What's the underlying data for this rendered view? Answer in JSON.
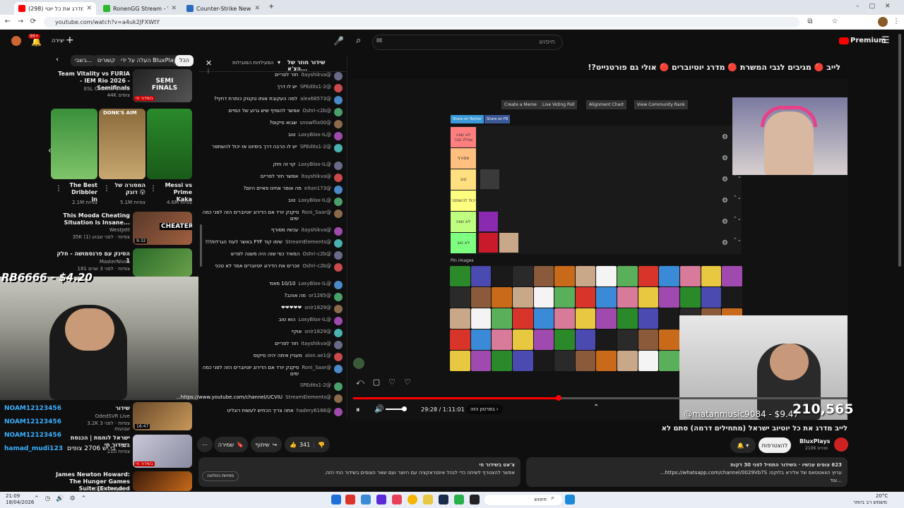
{
  "browser": {
    "tabs": [
      {
        "title": "(298) לייב מדרג את כל יוטי...",
        "active": true
      },
      {
        "title": "RonenGG Stream - Watch Live",
        "active": false
      },
      {
        "title": "Counter-Strike News & Covera...",
        "active": false
      }
    ],
    "new_tab": "+",
    "url": "youtube.com/watch?v=a4uk2JFXWtY"
  },
  "yt_header": {
    "notif_count": "99+",
    "create_label": "יצירה",
    "search_placeholder": "חיפוש",
    "premium_label": "Premium"
  },
  "sidebar": {
    "chips": [
      "הכל",
      "העלה על ידי BluxPlays",
      "קשורים",
      "בשבי..."
    ],
    "items": [
      {
        "title": "Team Vitality vs FURIA - IEM Rio 2026 - Semifinals",
        "channel": "ESL Counter-Strike",
        "meta": "44K צופים",
        "badge": "בשידור חי"
      },
      {
        "title": "This Mooda Cheating Situation is Insane...",
        "channel": "WestJett",
        "meta": "35K צפיות · לפני שבוע (1)",
        "badge": "9:32"
      },
      {
        "title": "הסינק עם פרנסמושה - חלק 1",
        "channel": "MasterNivos",
        "meta": "181 צפיות · לפני 3 שנים"
      },
      {
        "title": "שידור",
        "channel": "OdedSVR Live",
        "meta": "3.2K צפיות · לפני 3 שבועות",
        "badge": "16:47"
      },
      {
        "title": "ישראל לוחמת | הכנסת בשידור חי",
        "channel": "C14",
        "meta": "210 צפיות",
        "badge": "בשידור חי"
      },
      {
        "title": "James Newton Howard: The Hunger Games Suite [Extended",
        "channel": "Gilles Nuytens",
        "meta": ""
      }
    ],
    "shorts": [
      {
        "title": "The Best Dribbler in",
        "meta": "2.1M צפיות"
      },
      {
        "title": "המסורה של דונק 😮",
        "meta": "5.1M צפיות"
      },
      {
        "title": "Messi vs Prime Kaka",
        "meta": "4.6M צפיות"
      }
    ],
    "shorts_thumb_label": "DONK'S AIM",
    "semi_label": "SEMI FINALS",
    "cheater_label": "CHEATER?"
  },
  "overlay": {
    "donation": "RB6666 - $4.20",
    "chat_names": [
      "NOAM12123456",
      "NOAM12123456",
      "NOAM12123456",
      "hamad_mudi123"
    ],
    "chat_last": "כי יש 2706 צופים",
    "counter": "122"
  },
  "chat": {
    "title": "שידור חוזר של הצ'א...",
    "mode": "הפעילויות המובילות",
    "messages": [
      {
        "author": "@itayshikva",
        "text": "חזר לפריים"
      },
      {
        "author": "@SPEdits1-2",
        "text": "יש לו דרך"
      },
      {
        "author": "@alex68573",
        "text": "למה העקובת אותו טקנוק כותרת דחיף?"
      },
      {
        "author": "@Oshri-c2b",
        "text": "אפשר להוסיף שיש גרוע של המיים"
      },
      {
        "author": "@snowflix00",
        "text": "שבוא סיקוס?"
      },
      {
        "author": "@LoxyBlox-IL",
        "text": "טוב"
      },
      {
        "author": "@SPEdits1-2",
        "text": "יש לו הרבה דרך בימינט אז יכול להשתפר"
      },
      {
        "author": "@LoxyBlox-IL",
        "text": "קוי זה חזק"
      },
      {
        "author": "@itayshikva",
        "text": "אפשר חזר לפריים"
      },
      {
        "author": "@eitan173",
        "text": "מה אומר אחינו פאיים היום?"
      },
      {
        "author": "@LoxyBlox-IL",
        "text": "טוב"
      },
      {
        "author": "@Roni_Saar",
        "text": "סיקנק יורד אם הדירוג יוטיוברים הזה לפני כמה ימים"
      },
      {
        "author": "@itayshikva",
        "text": "עכשיו מסורף"
      },
      {
        "author": "@StreamElements",
        "text": "שימו קוד FYF באשר לעוד הגרלות!!!"
      },
      {
        "author": "@Oshri-c2b",
        "text": "המאיר כפי שזה היה משנה לפרש"
      },
      {
        "author": "@Oshri-c2b",
        "text": "זוכרים את הדירוג יוטיוברים אמר לא טכני"
      },
      {
        "author": "@LoxyBlox-IL",
        "text": "10/10 מאוד"
      },
      {
        "author": "@or1265",
        "text": "מה אוהב?"
      },
      {
        "author": "@snir1829",
        "text": "❤❤❤❤❤"
      },
      {
        "author": "@LoxyBlox-IL",
        "text": "הוא טוב"
      },
      {
        "author": "@snir1829",
        "text": "אוקיי"
      },
      {
        "author": "@itayshikva",
        "text": "חזר לפריים"
      },
      {
        "author": "@alon.ae1",
        "text": "מעניין אימה יהיה סיקוס"
      },
      {
        "author": "@Roni_Saar",
        "text": "סיקנק יורד אם הדירוג יוטיוברים הזה לפני כמה ימים"
      },
      {
        "author": "@SPEdits1-2",
        "text": ""
      },
      {
        "author": "@StreamElements",
        "text": "https://www.youtube.com/channel/UCVIU..."
      },
      {
        "author": "@hadery6166",
        "text": "אתה צריך הכחיש לעשות רוגליט"
      }
    ]
  },
  "video": {
    "title": "לייב 🔴 מגיבים לגבי המשרת 🔴 מדרג יוטיוברים 🔴 אולי גם פורטנייט?!",
    "tier_buttons": [
      "Create a Meme",
      "Live Voting Poll",
      "Alignment Chart",
      "View Community Rank"
    ],
    "share_buttons": [
      "Share on Twitter",
      "Share on FB"
    ],
    "tiers": [
      {
        "label": "לא שווה אפילו חבר",
        "color": "#ff7f7f"
      },
      {
        "label": "מסורף",
        "color": "#ffbf7f"
      },
      {
        "label": "טוב",
        "color": "#ffdf7f"
      },
      {
        "label": "יכול להשתפר",
        "color": "#ffff7f"
      },
      {
        "label": "לא שווה",
        "color": "#bfff7f"
      },
      {
        "label": "לא טוב",
        "color": "#7fff7f"
      }
    ],
    "pool_label": "Pin images",
    "cam_tag": "@matanmusic9084 - $9.47",
    "viewer_count": "210,565",
    "time_current": "29:28",
    "time_total": "1:11:01",
    "chapter_label": "בפרטון הזה",
    "progress": 0.415
  },
  "below": {
    "video_title": "לייב מדרג את כל יוטיוב ישראל (מתחילים דרמה) סתם לא",
    "channel_name": "BluxPlays",
    "subscribers": "210K מנויים",
    "subscribe_label": "להצטרפות",
    "likes": "341",
    "share_label": "שיתוף",
    "save_label": "שמירה",
    "desc_stats": "623 צופים עכשיו · השידור התחיל לפני 30 דקות",
    "desc_text": "ערוץ הוואטסאפ של אלירא בלוקס: https://whatsapp.com/channel/0029Vb7S...",
    "desc_more": "...עוד",
    "chat_box_title": "צ'אט בשידור חי",
    "chat_box_text": "אפשר להצטרף לשיחה כדי לנהל אינטראקציה עם היוצר ועם שאר הצופים בשידור החי הזה.",
    "chat_box_btn": "פתיחת החלונה"
  },
  "taskbar": {
    "time": "21:09",
    "date": "18/04/2026",
    "search_label": "חיפוש",
    "weather": "20°C",
    "weather_text": "משמש רב ביותר"
  },
  "colors": {
    "accent": "#ff0000",
    "bg": "#0f0f0f"
  }
}
